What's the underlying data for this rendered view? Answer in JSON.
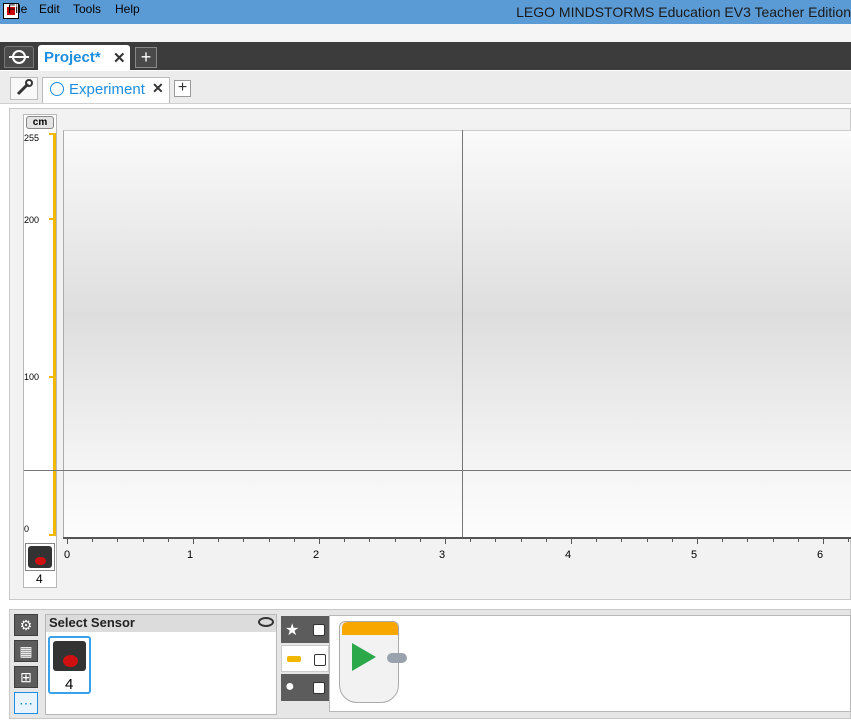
{
  "window": {
    "title": "LEGO MINDSTORMS Education EV3 Teacher Edition"
  },
  "menu": [
    "File",
    "Edit",
    "Tools",
    "Help"
  ],
  "project_tabs": {
    "active_label": "Project*",
    "close_glyph": "✕",
    "add_glyph": "+"
  },
  "sub_tabs": {
    "active_label": "Experiment",
    "close_glyph": "✕",
    "add_glyph": "+"
  },
  "graph": {
    "unit": "cm",
    "y_ticks": [
      "255",
      "200",
      "100",
      "0"
    ],
    "x_ticks": [
      "0",
      "1",
      "2",
      "3",
      "4",
      "5",
      "6"
    ],
    "sensor_port": "4"
  },
  "bottom": {
    "select_sensor_label": "Select Sensor",
    "sensor_card_port": "4",
    "side_buttons": [
      "gear-icon",
      "table-icon",
      "formula-icon",
      "dots-icon"
    ],
    "program_rows": [
      "star-icon",
      "dash-icon",
      "circle-icon"
    ]
  },
  "colors": {
    "accent": "#1d8de0",
    "axis_yellow": "#f2b700",
    "block_orange": "#f7a700",
    "play_green": "#2aa84a",
    "titlebar": "#5b9bd5"
  }
}
